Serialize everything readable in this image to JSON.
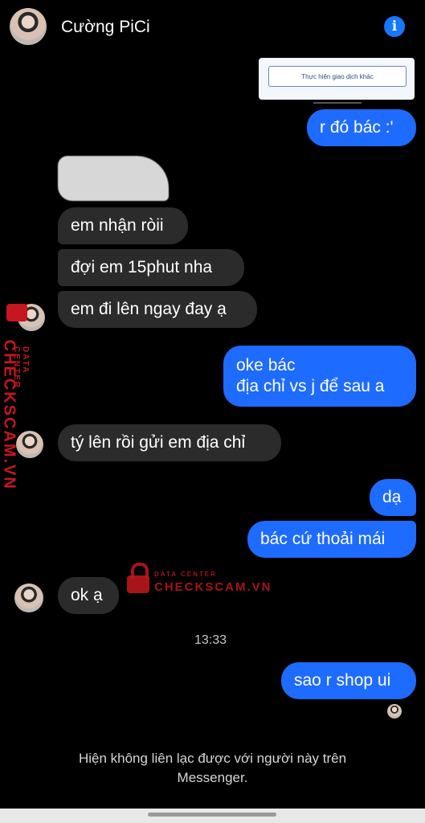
{
  "header": {
    "contact_name": "Cường PiCi"
  },
  "transaction_card": {
    "button_label": "Thực hiện giao dịch khác"
  },
  "messages": [
    {
      "side": "out",
      "text": "r đó bác :'"
    },
    {
      "side": "in",
      "text": "em nhận ròii"
    },
    {
      "side": "in",
      "text": "đợi em 15phut nha"
    },
    {
      "side": "in",
      "text": "em đi lên ngay đay ạ"
    },
    {
      "side": "out",
      "line1": "oke bác",
      "line2": "địa chỉ vs j để sau a"
    },
    {
      "side": "in",
      "text": "tý lên rồi gửi em địa chỉ"
    },
    {
      "side": "out",
      "text": "dạ"
    },
    {
      "side": "out",
      "text": "bác cứ thoải mái"
    },
    {
      "side": "in",
      "text": "ok ạ"
    },
    {
      "side": "out",
      "text": "sao r shop ui"
    }
  ],
  "timestamp": "13:33",
  "footer": {
    "line1": "Hiện không liên lạc được với người này trên",
    "line2": "Messenger."
  },
  "watermark": {
    "top": "DATA CENTER",
    "brand": "CHECKSCAM.VN"
  },
  "colors": {
    "outgoing": "#1e6bff",
    "incoming": "#2b2b2b",
    "accent": "#1677ff",
    "watermark": "#c4171f"
  }
}
